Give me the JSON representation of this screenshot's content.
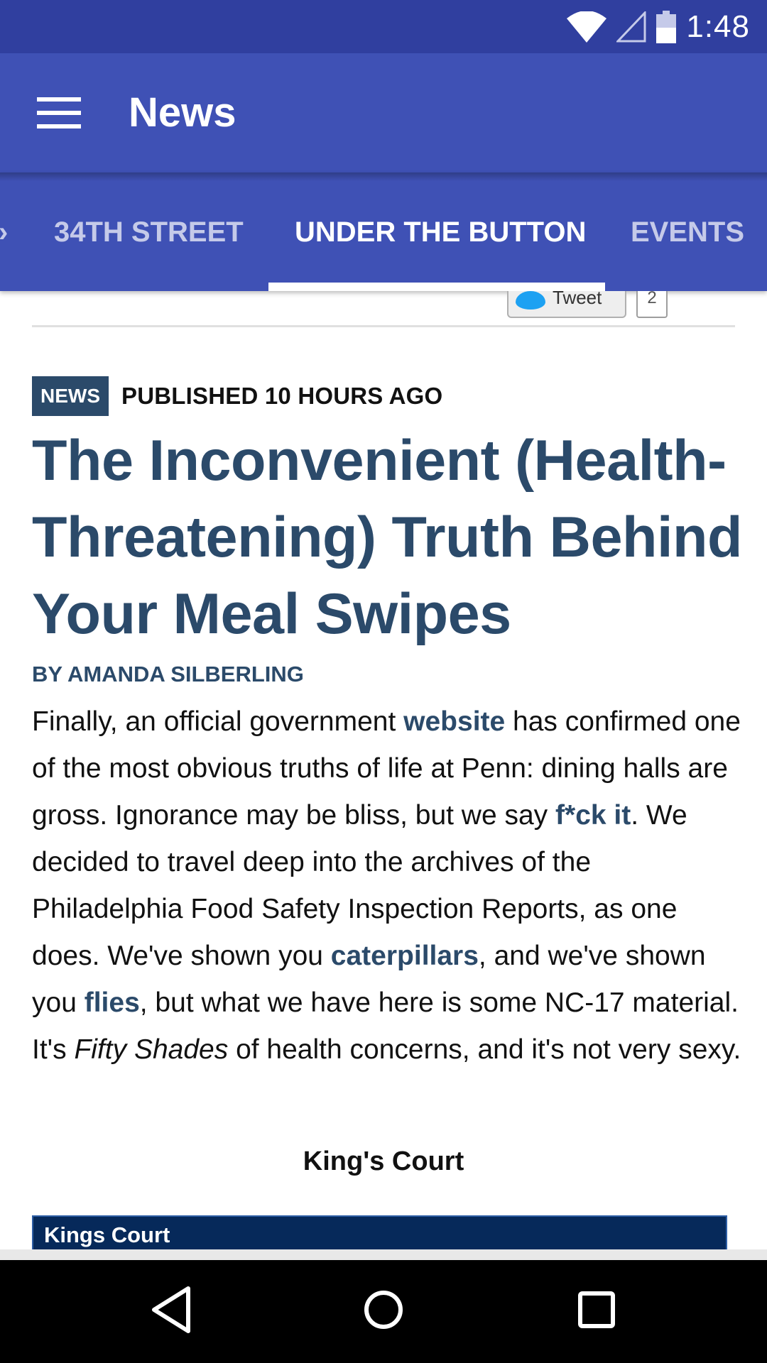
{
  "status_bar": {
    "time": "1:48",
    "icons": [
      "wifi-icon",
      "cell-signal-icon",
      "battery-icon"
    ]
  },
  "app_bar": {
    "title": "News",
    "menu_icon": "hamburger-menu-icon"
  },
  "tabs": [
    {
      "label": "34TH STREET",
      "active": false
    },
    {
      "label": "UNDER THE BUTTON",
      "active": true
    },
    {
      "label": "EVENTS",
      "active": false
    }
  ],
  "share": {
    "tweet_label": "Tweet",
    "tweet_count": "2"
  },
  "article": {
    "category_badge": "NEWS",
    "published": "PUBLISHED 10 HOURS AGO",
    "headline": "The Inconvenient (Health-Threatening) Truth Behind Your Meal Swipes",
    "byline": "BY AMANDA SILBERLING",
    "body": {
      "p1": "Finally, an official government ",
      "link_website": "website",
      "p2": " has confirmed one of the most obvious truths of life at Penn: dining halls are gross. Ignorance may be bliss, but we say ",
      "link_fck": "f*ck it",
      "p3": ". We decided to travel deep into the archives of the Philadelphia Food Safety Inspection Reports, as one does. We've shown you ",
      "link_caterpillars": "caterpillars",
      "p4": ", and we've shown you ",
      "link_flies": "flies",
      "p5": ", but what we have here is some NC-17 material. It's ",
      "italic": "Fifty Shades",
      "p6": " of health concerns, and it's not very sexy."
    },
    "subheading": "King's Court",
    "embed_label": "Kings Court"
  },
  "colors": {
    "status_bar": "#303f9f",
    "app_bar": "#3f51b5",
    "accent_text": "#2b4a6a",
    "inactive_tab": "#c5cae9"
  },
  "nav_bar": {
    "buttons": [
      "back-icon",
      "home-icon",
      "recents-icon"
    ]
  }
}
